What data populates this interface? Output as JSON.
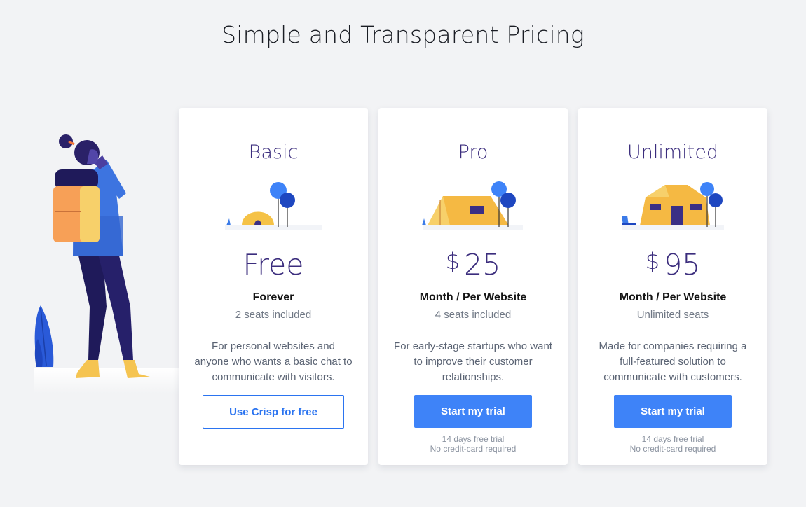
{
  "page": {
    "title": "Simple and Transparent Pricing"
  },
  "plans": [
    {
      "name": "Basic",
      "currency": "",
      "price": "Free",
      "period": "Forever",
      "seats": "2 seats included",
      "description": "For personal websites and anyone who wants a basic chat to communicate with visitors.",
      "cta": "Use Crisp for free",
      "note_line1": "",
      "note_line2": ""
    },
    {
      "name": "Pro",
      "currency": "$",
      "price": "25",
      "period": "Month / Per Website",
      "seats": "4 seats included",
      "description": "For early-stage startups who want to improve their customer relationships.",
      "cta": "Start my trial",
      "note_line1": "14 days free trial",
      "note_line2": "No credit-card required"
    },
    {
      "name": "Unlimited",
      "currency": "$",
      "price": "95",
      "period": "Month / Per Website",
      "seats": "Unlimited seats",
      "description": "Made for companies requiring a full-featured solution to communicate with customers.",
      "cta": "Start my trial",
      "note_line1": "14 days free trial",
      "note_line2": "No credit-card required"
    }
  ],
  "colors": {
    "accent": "#3e83f8",
    "plan_text": "#3b2d7d",
    "background": "#f2f3f5"
  },
  "icons": [
    "hiker-backpack-illustration",
    "small-tent-icon",
    "medium-tent-icon",
    "large-tent-icon"
  ]
}
